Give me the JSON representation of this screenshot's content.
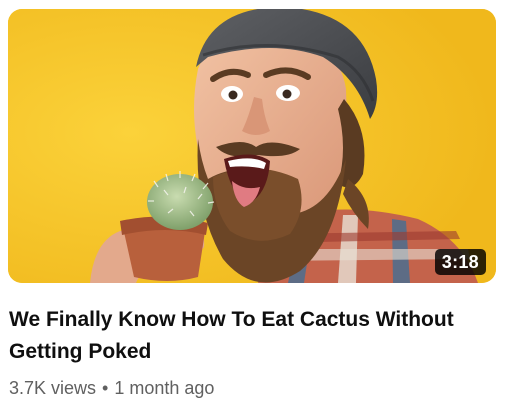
{
  "video": {
    "title": "We Finally Know How To Eat Cactus Without Getting Poked",
    "duration": "3:18",
    "views": "3.7K views",
    "separator": "•",
    "age": "1 month ago"
  },
  "thumbnail": {
    "background_color": "#f6c62a",
    "subject": "bearded-man-biting-cactus"
  }
}
